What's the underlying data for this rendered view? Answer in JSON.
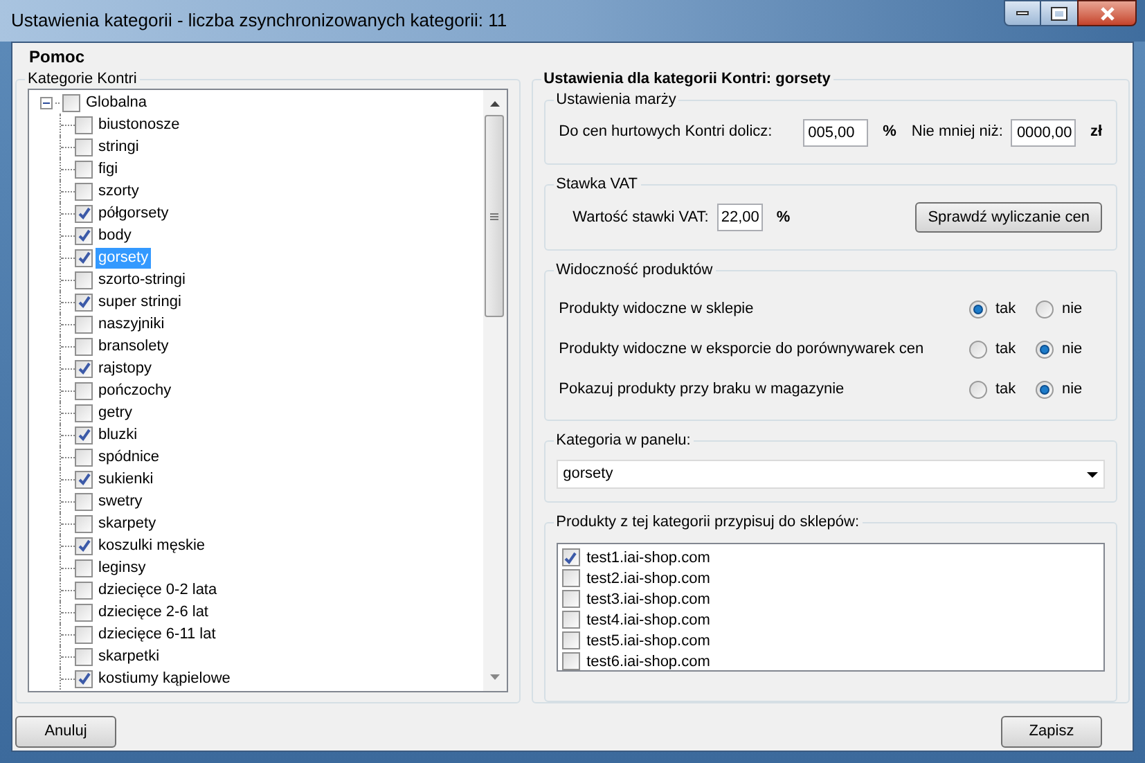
{
  "window": {
    "title": "Ustawienia kategorii - liczba zsynchronizowanych kategorii: 11"
  },
  "menu": [
    "Pomoc"
  ],
  "tree": {
    "title": "Kategorie Kontri",
    "root": {
      "label": "Globalna",
      "checked": false,
      "expanded": true,
      "children": [
        {
          "label": "biustonosze",
          "checked": false,
          "selected": false
        },
        {
          "label": "stringi",
          "checked": false,
          "selected": false
        },
        {
          "label": "figi",
          "checked": false,
          "selected": false
        },
        {
          "label": "szorty",
          "checked": false,
          "selected": false
        },
        {
          "label": "półgorsety",
          "checked": true,
          "selected": false
        },
        {
          "label": "body",
          "checked": true,
          "selected": false
        },
        {
          "label": "gorsety",
          "checked": true,
          "selected": true
        },
        {
          "label": "szorto-stringi",
          "checked": false,
          "selected": false
        },
        {
          "label": "super stringi",
          "checked": true,
          "selected": false
        },
        {
          "label": "naszyjniki",
          "checked": false,
          "selected": false
        },
        {
          "label": "bransolety",
          "checked": false,
          "selected": false
        },
        {
          "label": "rajstopy",
          "checked": true,
          "selected": false
        },
        {
          "label": "pończochy",
          "checked": false,
          "selected": false
        },
        {
          "label": "getry",
          "checked": false,
          "selected": false
        },
        {
          "label": "bluzki",
          "checked": true,
          "selected": false
        },
        {
          "label": "spódnice",
          "checked": false,
          "selected": false
        },
        {
          "label": "sukienki",
          "checked": true,
          "selected": false
        },
        {
          "label": "swetry",
          "checked": false,
          "selected": false
        },
        {
          "label": "skarpety",
          "checked": false,
          "selected": false
        },
        {
          "label": "koszulki męskie",
          "checked": true,
          "selected": false
        },
        {
          "label": "leginsy",
          "checked": false,
          "selected": false
        },
        {
          "label": "dziecięce 0-2 lata",
          "checked": false,
          "selected": false
        },
        {
          "label": "dziecięce 2-6 lat",
          "checked": false,
          "selected": false
        },
        {
          "label": "dziecięce 6-11 lat",
          "checked": false,
          "selected": false
        },
        {
          "label": "skarpetki",
          "checked": false,
          "selected": false
        },
        {
          "label": "kostiumy kąpielowe",
          "checked": true,
          "selected": false
        }
      ]
    }
  },
  "settings": {
    "title": "Ustawienia dla kategorii Kontri: gorsety",
    "margin": {
      "title": "Ustawienia marży",
      "label": "Do cen hurtowych Kontri dolicz:",
      "value": "005,00",
      "unit": "%",
      "min_label": "Nie mniej niż:",
      "min_value": "0000,00",
      "min_unit": "zł"
    },
    "vat": {
      "title": "Stawka VAT",
      "label": "Wartość stawki VAT:",
      "value": "22,00",
      "unit": "%",
      "button": "Sprawdź wyliczanie cen"
    },
    "visibility": {
      "title": "Widoczność produktów",
      "rows": [
        {
          "label": "Produkty widoczne w sklepie",
          "options": [
            {
              "label": "tak",
              "selected": true
            },
            {
              "label": "nie",
              "selected": false
            }
          ]
        },
        {
          "label": "Produkty widoczne w eksporcie do porównywarek cen",
          "options": [
            {
              "label": "tak",
              "selected": false
            },
            {
              "label": "nie",
              "selected": true
            }
          ]
        },
        {
          "label": "Pokazuj produkty przy braku w magazynie",
          "options": [
            {
              "label": "tak",
              "selected": false
            },
            {
              "label": "nie",
              "selected": true
            }
          ]
        }
      ]
    },
    "panel_category": {
      "title": "Kategoria w panelu:",
      "value": "gorsety"
    },
    "shops": {
      "title": "Produkty z tej kategorii przypisuj do sklepów:",
      "items": [
        {
          "label": "test1.iai-shop.com",
          "checked": true
        },
        {
          "label": "test2.iai-shop.com",
          "checked": false
        },
        {
          "label": "test3.iai-shop.com",
          "checked": false
        },
        {
          "label": "test4.iai-shop.com",
          "checked": false
        },
        {
          "label": "test5.iai-shop.com",
          "checked": false
        },
        {
          "label": "test6.iai-shop.com",
          "checked": false
        }
      ]
    }
  },
  "buttons": {
    "cancel": "Anuluj",
    "save": "Zapisz"
  }
}
